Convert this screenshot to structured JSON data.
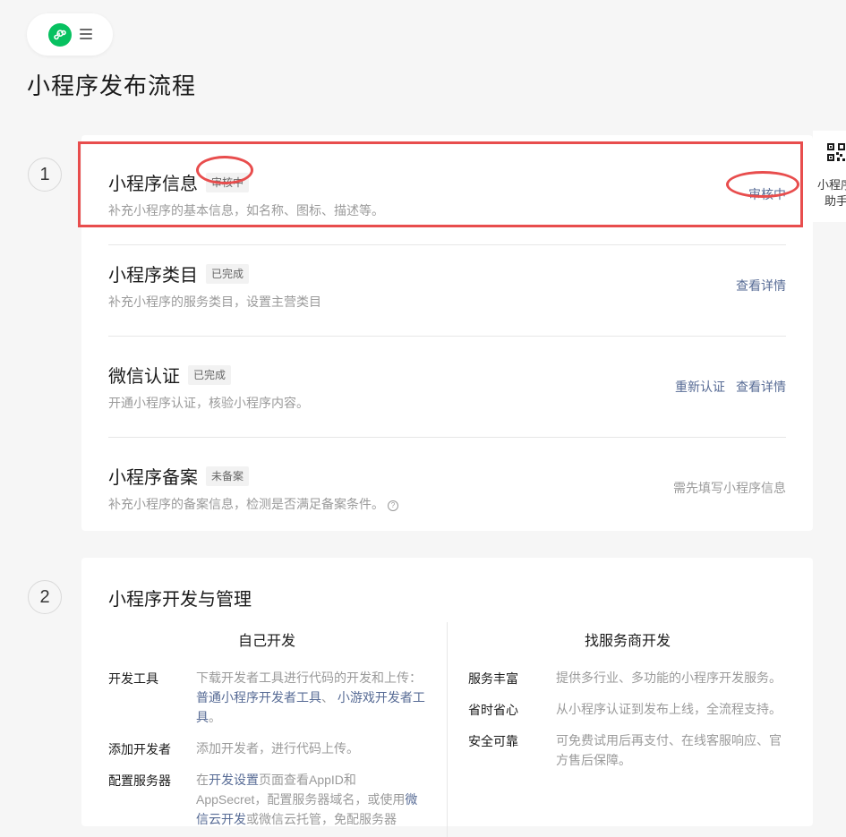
{
  "page_title": "小程序发布流程",
  "steps": [
    {
      "number": "1"
    },
    {
      "number": "2"
    }
  ],
  "step1_rows": [
    {
      "title": "小程序信息",
      "badge": "审核中",
      "desc": "补充小程序的基本信息，如名称、图标、描述等。",
      "actions": [
        {
          "label": "审核中",
          "type": "link"
        }
      ]
    },
    {
      "title": "小程序类目",
      "badge": "已完成",
      "desc": "补充小程序的服务类目，设置主营类目",
      "actions": [
        {
          "label": "查看详情",
          "type": "link"
        }
      ]
    },
    {
      "title": "微信认证",
      "badge": "已完成",
      "desc": "开通小程序认证，核验小程序内容。",
      "actions": [
        {
          "label": "重新认证",
          "type": "link"
        },
        {
          "label": "查看详情",
          "type": "link"
        }
      ]
    },
    {
      "title": "小程序备案",
      "badge": "未备案",
      "desc": "补充小程序的备案信息，检测是否满足备案条件。",
      "help_icon": "?",
      "actions": [
        {
          "label": "需先填写小程序信息",
          "type": "muted"
        }
      ]
    }
  ],
  "side_panel": {
    "line1": "小程序",
    "line2": "助手"
  },
  "step2": {
    "title": "小程序开发与管理",
    "left_column": {
      "title": "自己开发",
      "items": [
        {
          "label": "开发工具",
          "desc_prefix": "下载开发者工具进行代码的开发和上传：",
          "link1": "普通小程序开发者工具",
          "sep": "、",
          "link2": "小游戏开发者工具",
          "desc_suffix": "。"
        },
        {
          "label": "添加开发者",
          "desc": "添加开发者，进行代码上传。"
        },
        {
          "label": "配置服务器",
          "desc_prefix": "在",
          "link1": "开发设置",
          "desc_mid": "页面查看AppID和AppSecret，配置服务器域名，或使用",
          "link2": "微信云开发",
          "desc_suffix": "或微信云托管，免配服务器"
        }
      ]
    },
    "right_column": {
      "title": "找服务商开发",
      "items": [
        {
          "label": "服务丰富",
          "desc": "提供多行业、多功能的小程序开发服务。"
        },
        {
          "label": "省时省心",
          "desc": "从小程序认证到发布上线，全流程支持。"
        },
        {
          "label": "安全可靠",
          "desc": "可免费试用后再支付、在线客服响应、官方售后保障。"
        }
      ]
    }
  },
  "colors": {
    "link": "#576b95",
    "highlight": "#e84d4d",
    "brand": "#07c160"
  }
}
